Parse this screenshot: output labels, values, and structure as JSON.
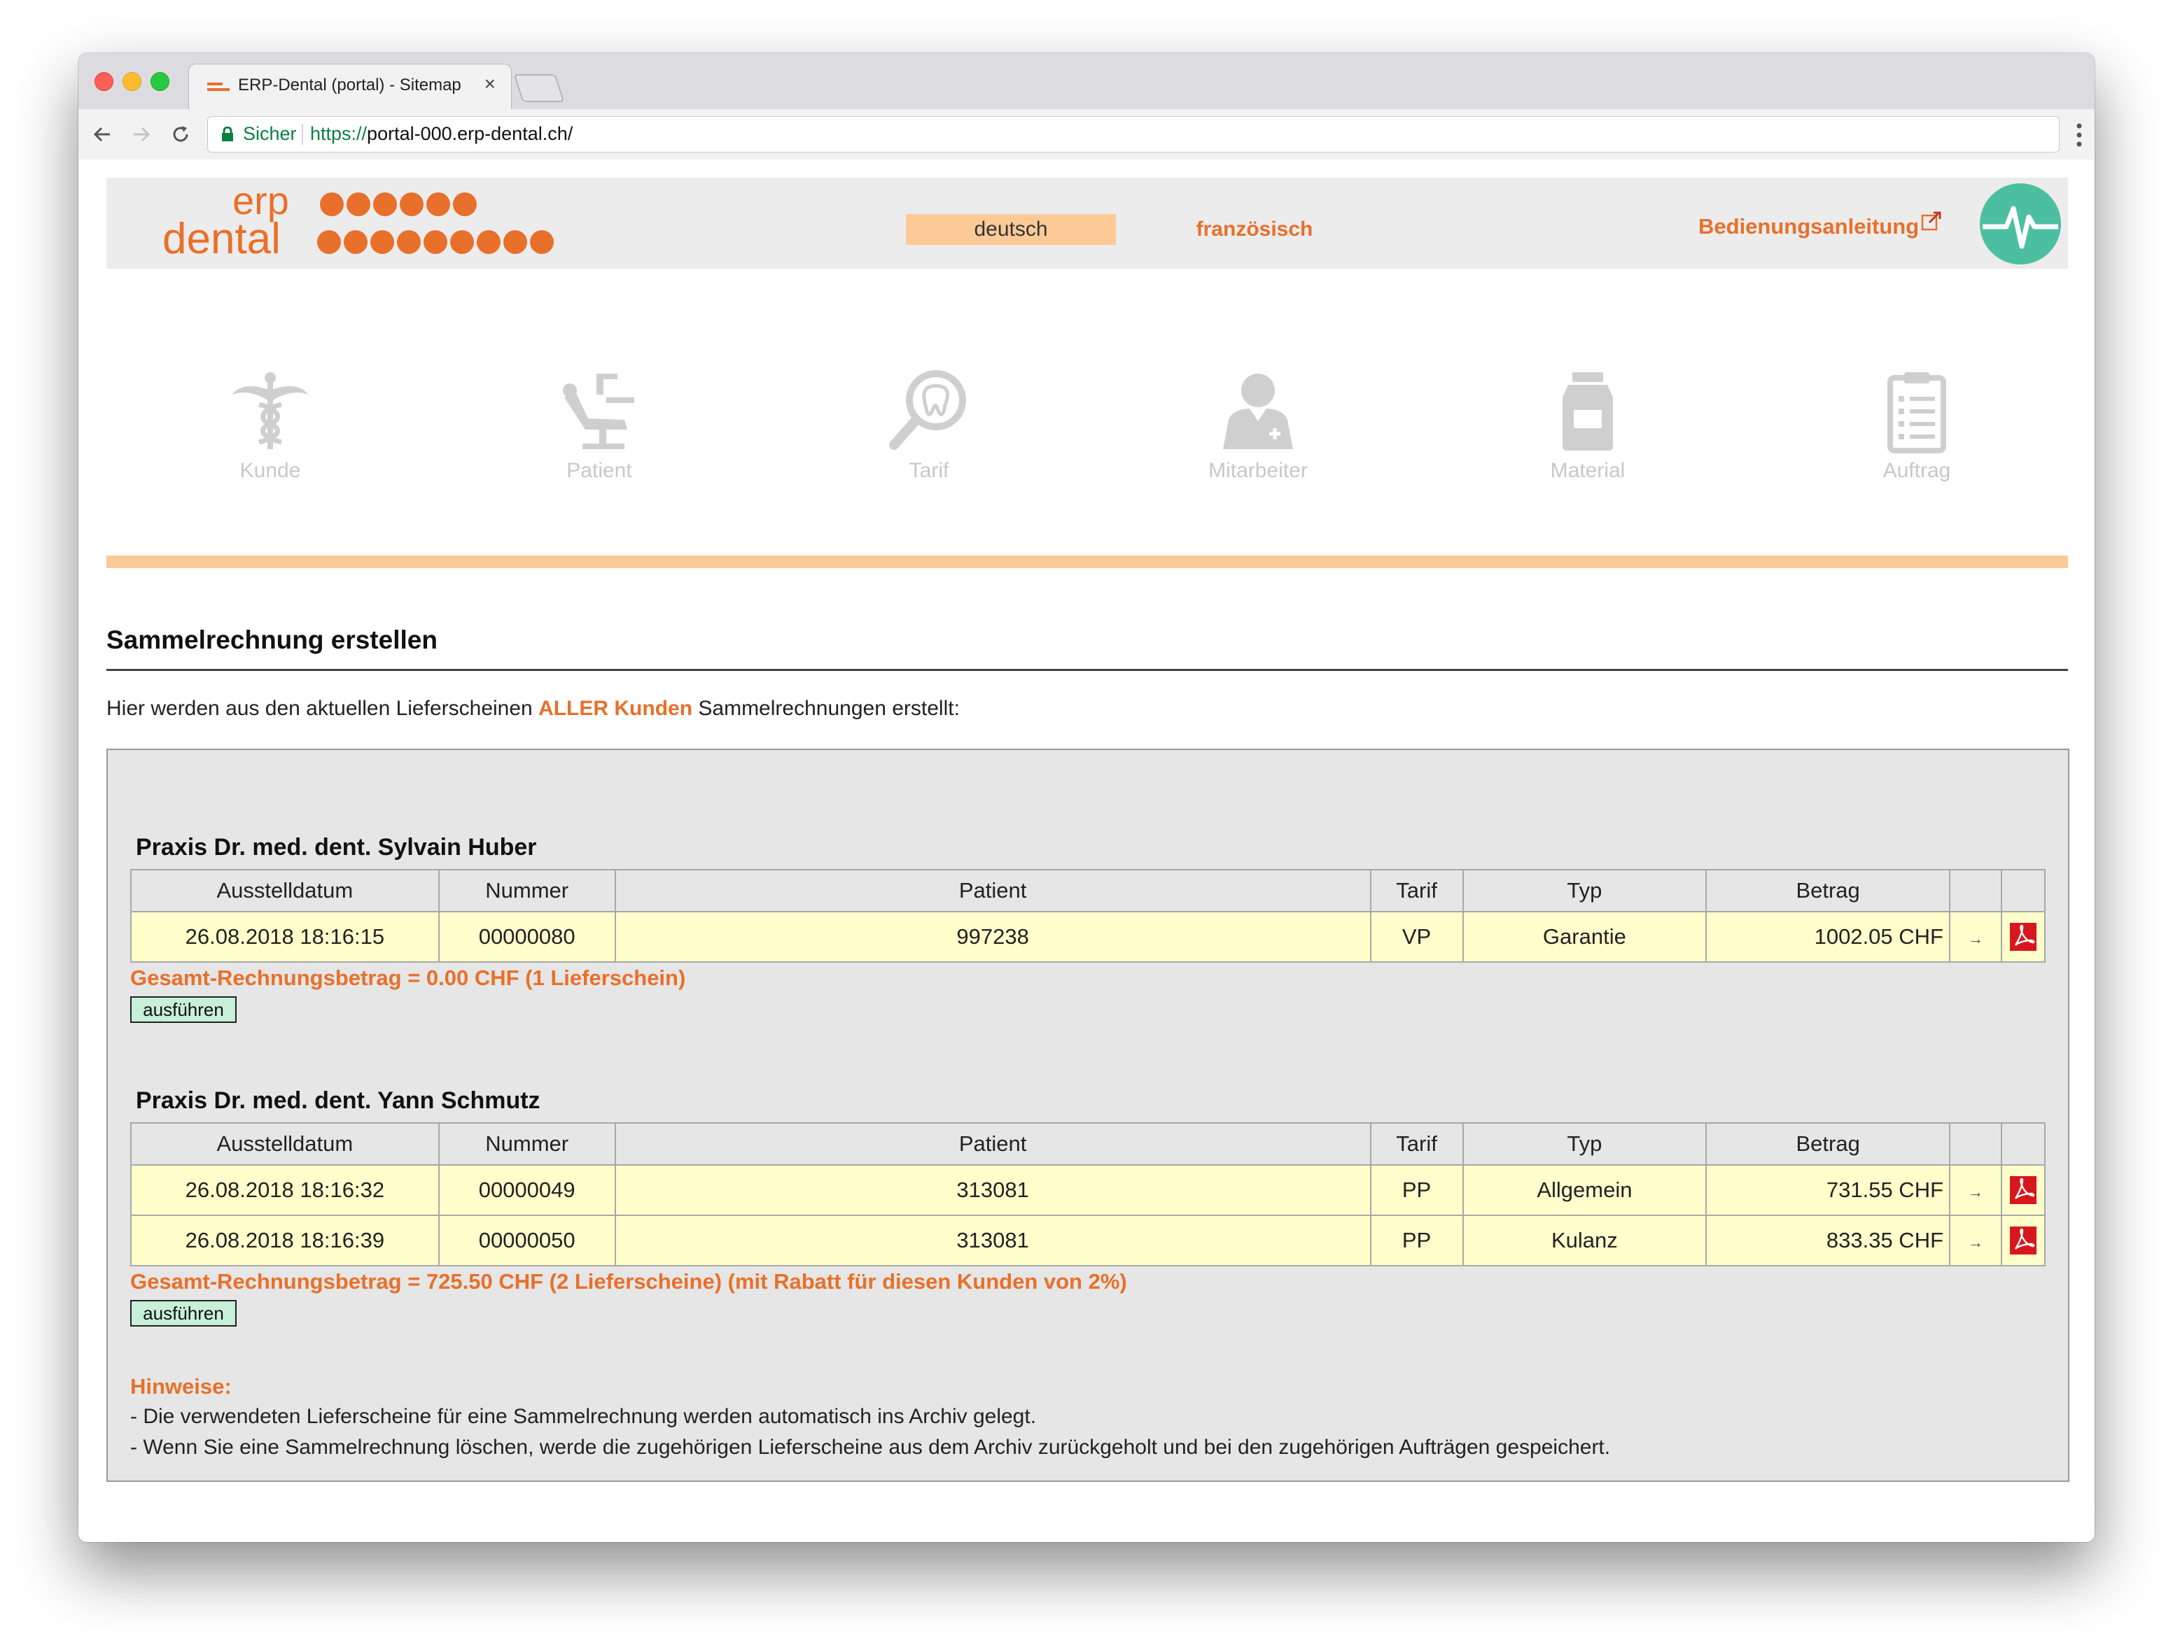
{
  "browser": {
    "tab_title": "ERP-Dental (portal) - Sitemap",
    "tab_close": "×",
    "secure_label": "Sicher",
    "url_scheme": "https://",
    "url_rest": "portal-000.erp-dental.ch/"
  },
  "header": {
    "logo_line1": "erp",
    "logo_line2": "dental",
    "lang_active": "deutsch",
    "lang_other": "französisch",
    "manual_link": "Bedienungsanleitung"
  },
  "nav": [
    {
      "label": "Kunde",
      "icon": "caduceus-icon"
    },
    {
      "label": "Patient",
      "icon": "dental-chair-icon"
    },
    {
      "label": "Tarif",
      "icon": "tooth-magnifier-icon"
    },
    {
      "label": "Mitarbeiter",
      "icon": "doctor-icon"
    },
    {
      "label": "Material",
      "icon": "jar-icon"
    },
    {
      "label": "Auftrag",
      "icon": "clipboard-icon"
    }
  ],
  "main": {
    "title": "Sammelrechnung erstellen",
    "intro_before": "Hier werden aus den aktuellen Lieferscheinen ",
    "intro_highlight": "ALLER Kunden",
    "intro_after": " Sammelrechnungen erstellt:",
    "columns": [
      "Ausstelldatum",
      "Nummer",
      "Patient",
      "Tarif",
      "Typ",
      "Betrag",
      "",
      ""
    ],
    "execute_label": "ausführen",
    "arrow_glyph": "→",
    "customers": [
      {
        "name": "Praxis Dr. med. dent. Sylvain Huber",
        "rows": [
          {
            "date": "26.08.2018 18:16:15",
            "number": "00000080",
            "patient": "997238",
            "tarif": "VP",
            "typ": "Garantie",
            "amount": "1002.05 CHF"
          }
        ],
        "total": "Gesamt-Rechnungsbetrag = 0.00 CHF (1 Lieferschein)"
      },
      {
        "name": "Praxis Dr. med. dent. Yann Schmutz",
        "rows": [
          {
            "date": "26.08.2018 18:16:32",
            "number": "00000049",
            "patient": "313081",
            "tarif": "PP",
            "typ": "Allgemein",
            "amount": "731.55 CHF"
          },
          {
            "date": "26.08.2018 18:16:39",
            "number": "00000050",
            "patient": "313081",
            "tarif": "PP",
            "typ": "Kulanz",
            "amount": "833.35 CHF"
          }
        ],
        "total": "Gesamt-Rechnungsbetrag = 725.50 CHF (2 Lieferscheine) (mit Rabatt für diesen Kunden von 2%)"
      }
    ],
    "notes_title": "Hinweise:",
    "notes": [
      "- Die verwendeten Lieferscheine für eine Sammelrechnung werden automatisch ins Archiv gelegt.",
      "- Wenn Sie eine Sammelrechnung löschen, werde die zugehörigen Lieferscheine aus dem Archiv zurückgeholt und bei den zugehörigen Aufträgen gespeichert."
    ]
  },
  "colors": {
    "brand_orange": "#e8702a",
    "accent_peach": "#fcca96",
    "row_yellow": "#ffffcc",
    "button_green": "#c8f0d8",
    "logo_teal": "#4cbfa1"
  }
}
